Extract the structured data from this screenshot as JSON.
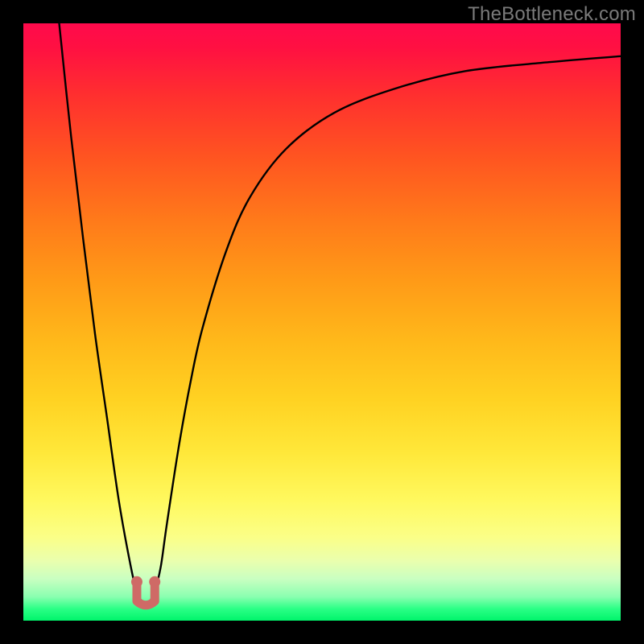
{
  "watermark": "TheBottleneck.com",
  "chart_data": {
    "type": "line",
    "title": "",
    "xlabel": "",
    "ylabel": "",
    "xlim": [
      0,
      100
    ],
    "ylim": [
      0,
      100
    ],
    "gradient_meaning": "vertical gradient from red (top, high bottleneck) through orange/yellow to green (bottom, no bottleneck)",
    "series": [
      {
        "name": "bottleneck-curve",
        "color": "#000000",
        "x": [
          6,
          8,
          10,
          12,
          14,
          16,
          18,
          19,
          20,
          21,
          22,
          23,
          24,
          26,
          28,
          30,
          34,
          38,
          44,
          52,
          62,
          74,
          88,
          100
        ],
        "values": [
          100,
          81,
          64,
          48,
          34,
          20,
          9,
          5,
          3,
          3,
          5,
          9,
          16,
          29,
          40,
          49,
          62,
          71,
          79,
          85,
          89,
          92,
          93.5,
          94.5
        ]
      }
    ],
    "marker": {
      "name": "optimal-range-marker",
      "color": "#cf6a66",
      "x_range": [
        19,
        22
      ],
      "y": 3
    }
  }
}
